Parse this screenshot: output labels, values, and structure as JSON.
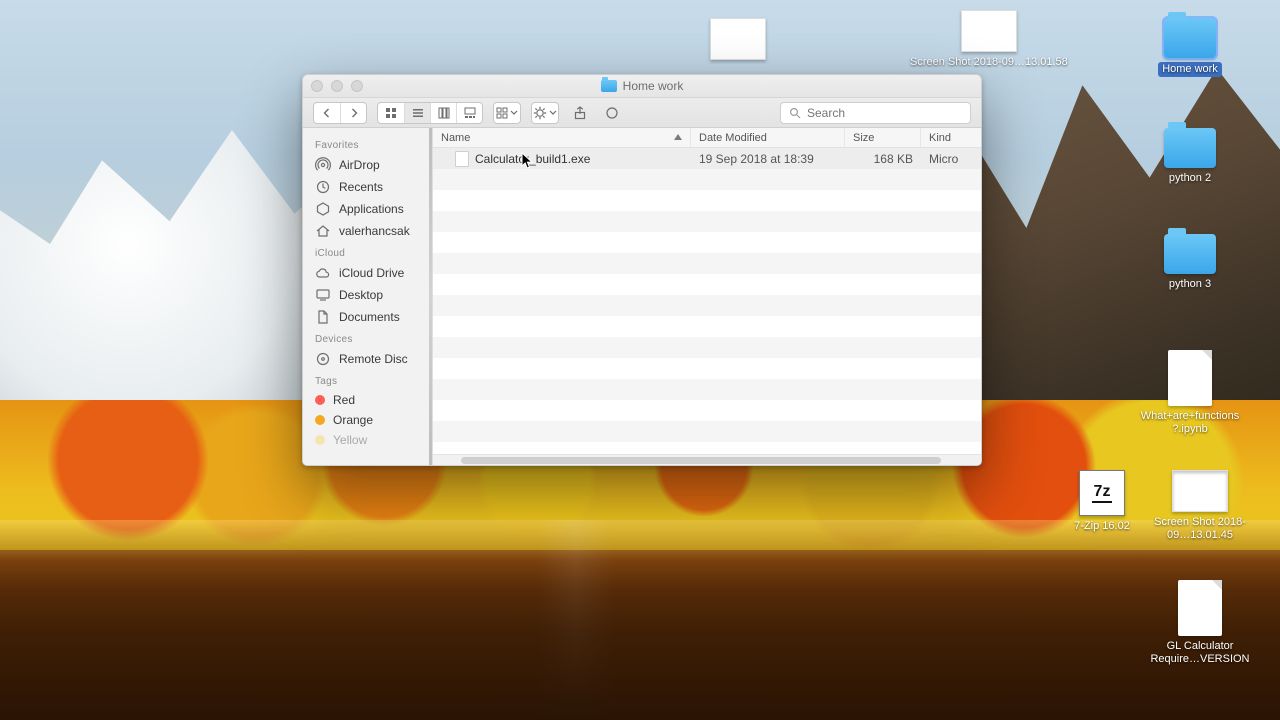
{
  "window": {
    "title": "Home work",
    "search_placeholder": "Search"
  },
  "sidebar": {
    "sections": [
      {
        "key": "favorites",
        "heading": "Favorites",
        "items": [
          {
            "icon": "airdrop",
            "label": "AirDrop"
          },
          {
            "icon": "recents",
            "label": "Recents"
          },
          {
            "icon": "apps",
            "label": "Applications"
          },
          {
            "icon": "home",
            "label": "valerhancsak"
          }
        ]
      },
      {
        "key": "icloud",
        "heading": "iCloud",
        "items": [
          {
            "icon": "cloud",
            "label": "iCloud Drive"
          },
          {
            "icon": "desktop",
            "label": "Desktop"
          },
          {
            "icon": "docs",
            "label": "Documents"
          }
        ]
      },
      {
        "key": "devices",
        "heading": "Devices",
        "items": [
          {
            "icon": "disc",
            "label": "Remote Disc"
          }
        ]
      },
      {
        "key": "tags",
        "heading": "Tags",
        "items": [
          {
            "icon": "dot",
            "color": "#ff5f57",
            "label": "Red"
          },
          {
            "icon": "dot",
            "color": "#f5a623",
            "label": "Orange"
          },
          {
            "icon": "dot",
            "color": "#f7d44c",
            "label": "Yellow"
          }
        ]
      }
    ]
  },
  "columns": {
    "name": "Name",
    "date": "Date Modified",
    "size": "Size",
    "kind": "Kind"
  },
  "rows": [
    {
      "name": "Calculator_build1.exe",
      "date": "19 Sep 2018 at 18:39",
      "size": "168 KB",
      "kind": "Micro"
    }
  ],
  "desktop": {
    "top_thumbs": [
      {
        "key": "thumb-1",
        "label": ""
      },
      {
        "key": "thumb-2",
        "label": "Screen Shot 2018-09…13.01.58"
      }
    ],
    "right": [
      {
        "key": "homework",
        "kind": "folder",
        "selected": true,
        "label": "Home work"
      },
      {
        "key": "python2",
        "kind": "folder",
        "selected": false,
        "label": "python 2"
      },
      {
        "key": "python3",
        "kind": "folder",
        "selected": false,
        "label": "python 3"
      },
      {
        "key": "functions",
        "kind": "file",
        "selected": false,
        "label": "What+are+functions?.ipynb"
      },
      {
        "key": "sevenzip",
        "kind": "7z",
        "selected": false,
        "label": "7-Zip 16.02"
      },
      {
        "key": "sshot",
        "kind": "scr",
        "selected": false,
        "label": "Screen Shot 2018-09…13.01.45"
      },
      {
        "key": "glcalc",
        "kind": "file",
        "selected": false,
        "label": "GL Calculator Require…VERSION"
      }
    ]
  }
}
